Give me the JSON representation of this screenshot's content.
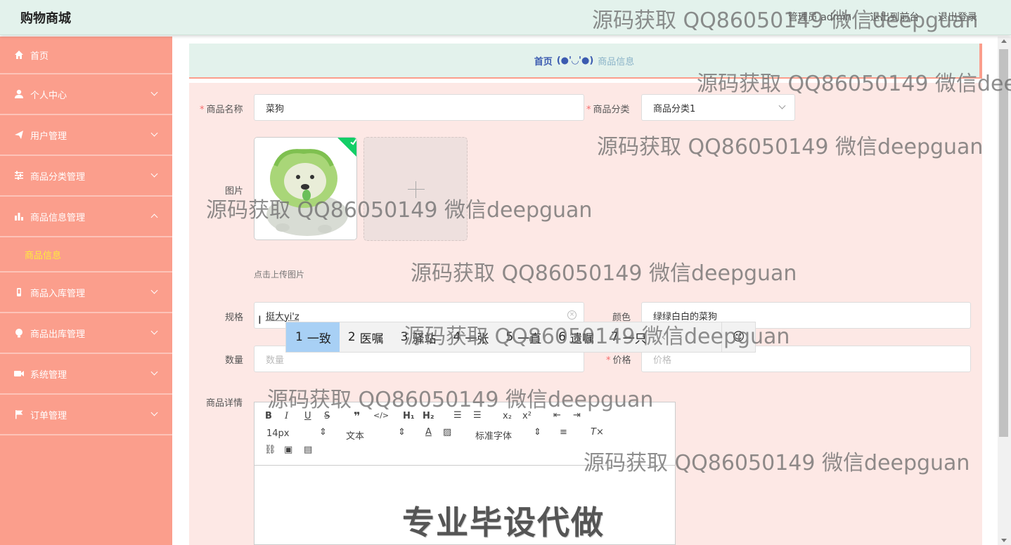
{
  "header": {
    "brand": "购物商城",
    "admin_text": "管理员 admin",
    "front_link": "退出到前台",
    "logout": "退出登录"
  },
  "sidebar": {
    "items": [
      {
        "label": "首页",
        "icon": "home-icon"
      },
      {
        "label": "个人中心",
        "icon": "user-icon"
      },
      {
        "label": "用户管理",
        "icon": "send-icon"
      },
      {
        "label": "商品分类管理",
        "icon": "sliders-icon"
      },
      {
        "label": "商品信息管理",
        "icon": "bar-chart-icon",
        "expanded": true
      },
      {
        "label": "商品入库管理",
        "icon": "phone-icon"
      },
      {
        "label": "商品出库管理",
        "icon": "bulb-icon"
      },
      {
        "label": "系统管理",
        "icon": "camera-icon"
      },
      {
        "label": "订单管理",
        "icon": "flag-icon"
      }
    ],
    "sub_item": "商品信息"
  },
  "breadcrumb": {
    "home": "首页",
    "face": "(●'◡'●)",
    "current": "商品信息"
  },
  "form": {
    "name_label": "商品名称",
    "name_value": "菜狗",
    "category_label": "商品分类",
    "category_value": "商品分类1",
    "image_label": "图片",
    "upload_hint": "点击上传图片",
    "spec_label": "规格",
    "spec_value": "挺大yi'z",
    "color_label": "颜色",
    "color_value": "绿绿白白的菜狗",
    "qty_label": "数量",
    "qty_placeholder": "数量",
    "price_label": "价格",
    "price_placeholder": "价格",
    "detail_label": "商品详情"
  },
  "ime": {
    "candidates": [
      {
        "n": "1",
        "text": "一致"
      },
      {
        "n": "2",
        "text": "医嘱"
      },
      {
        "n": "3",
        "text": "驿站"
      },
      {
        "n": "4",
        "text": "一张"
      },
      {
        "n": "5",
        "text": "一直"
      },
      {
        "n": "6",
        "text": "遗嘱"
      },
      {
        "n": "7",
        "text": "一只"
      }
    ],
    "prev": "‹",
    "next": "›",
    "emoji": "☺"
  },
  "editor": {
    "font_size": "14px",
    "block_type": "文本",
    "font_family": "标准字体",
    "body_image_text": "专业毕设代做"
  },
  "watermarks": [
    "源码获取 QQ86050149 微信deepguan",
    "源码获取 QQ86050149 微信dee",
    "源码获取 QQ86050149 微信deepguan",
    "源码获取 QQ86050149 微信deepguan",
    "源码获取 QQ86050149 微信deepguan",
    "源码获取 QQ86050149 微信deepguan",
    "源码获取 QQ86050149 微信deepguan",
    "源码获取 QQ86050149 微信deepguan"
  ]
}
